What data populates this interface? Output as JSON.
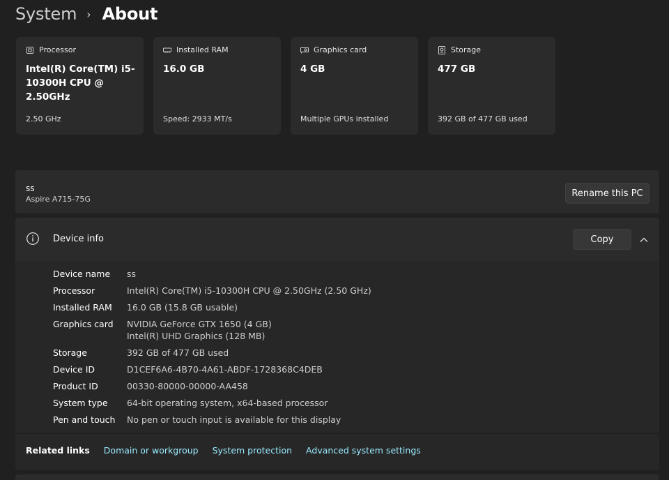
{
  "breadcrumb": {
    "parent": "System",
    "separator": "›",
    "current": "About"
  },
  "cards": [
    {
      "title": "Processor",
      "icon": "processor-icon",
      "value": "Intel(R) Core(TM) i5-10300H CPU @ 2.50GHz",
      "sub": "2.50 GHz"
    },
    {
      "title": "Installed RAM",
      "icon": "ram-icon",
      "value": "16.0 GB",
      "sub": "Speed: 2933 MT/s"
    },
    {
      "title": "Graphics card",
      "icon": "graphics-card-icon",
      "value": "4 GB",
      "sub": "Multiple GPUs installed"
    },
    {
      "title": "Storage",
      "icon": "storage-icon",
      "value": "477 GB",
      "sub": "392 GB of 477 GB used"
    }
  ],
  "pc": {
    "name": "ss",
    "model": "Aspire A715-75G",
    "rename_label": "Rename this PC"
  },
  "device_info": {
    "title": "Device info",
    "copy_label": "Copy",
    "specs": [
      {
        "label": "Device name",
        "value": "ss"
      },
      {
        "label": "Processor",
        "value": "Intel(R) Core(TM) i5-10300H CPU @ 2.50GHz (2.50 GHz)"
      },
      {
        "label": "Installed RAM",
        "value": "16.0 GB (15.8 GB usable)"
      },
      {
        "label": "Graphics card",
        "value": "NVIDIA GeForce GTX 1650 (4 GB)",
        "value2": "Intel(R) UHD Graphics (128 MB)"
      },
      {
        "label": "Storage",
        "value": "392 GB of 477 GB used"
      },
      {
        "label": "Device ID",
        "value": "D1CEF6A6-4B70-4A61-ABDF-1728368C4DEB"
      },
      {
        "label": "Product ID",
        "value": "00330-80000-00000-AA458"
      },
      {
        "label": "System type",
        "value": "64-bit operating system, x64-based processor"
      },
      {
        "label": "Pen and touch",
        "value": "No pen or touch input is available for this display"
      }
    ]
  },
  "related_links": {
    "title": "Related links",
    "links": [
      "Domain or workgroup",
      "System protection",
      "Advanced system settings"
    ]
  },
  "colors": {
    "background": "#202020",
    "card": "#2b2b2b",
    "link": "#99ebff"
  }
}
